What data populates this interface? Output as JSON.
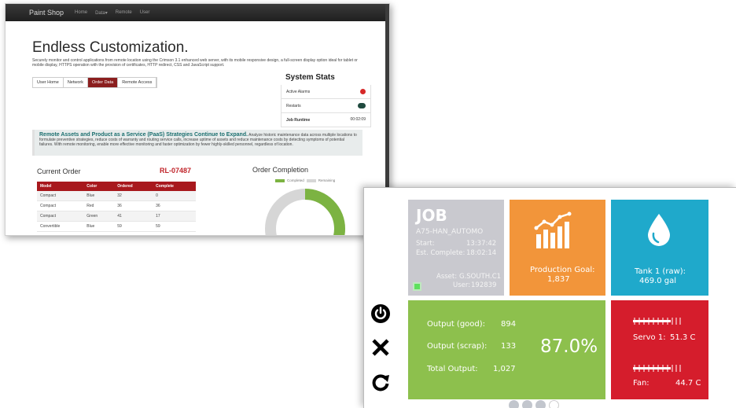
{
  "web": {
    "brand": "Paint Shop",
    "nav": [
      "Home",
      "Data▾",
      "Remote",
      "User"
    ],
    "headline": "Endless Customization.",
    "intro": "Securely monitor and control applications from remote location using the Crimson 3.1 enhanced web server, with its mobile responsive design, a full-screen display option ideal for tablet or mobile display, HTTPS operation with the provision of certificates, HTTP redirect, CSS and JavaScript support.",
    "tabs": [
      {
        "label": "User Home",
        "active": false
      },
      {
        "label": "Network",
        "active": false
      },
      {
        "label": "Order Data",
        "active": true
      },
      {
        "label": "Remote Access",
        "active": false
      }
    ],
    "stats": {
      "title": "System Stats",
      "rows": [
        {
          "label": "Active Alarms",
          "value": "1"
        },
        {
          "label": "Restarts",
          "value": "0"
        },
        {
          "label": "Job Runtime",
          "value": "00:02:09"
        }
      ]
    },
    "banner": {
      "heading": "Remote Assets and Product as a Service (PaaS) Strategies Continue to Expand.",
      "body": "Analyze historic maintenance data across multiple locations to formulate preventive strategies, reduce costs of warranty and routing service calls, increase uptime of assets and reduce maintenance costs by detecting symptoms of potential failures. With remote monitoring, enable more effective monitoring and faster optimization by fewer highly-skilled personnel, regardless of location."
    },
    "current_order": {
      "title": "Current Order",
      "order_id": "RL-07487",
      "columns": [
        "Model",
        "Color",
        "Ordered",
        "Complete"
      ],
      "rows": [
        [
          "Compact",
          "Blue",
          "32",
          "0"
        ],
        [
          "Compact",
          "Red",
          "36",
          "36"
        ],
        [
          "Compact",
          "Green",
          "41",
          "17"
        ],
        [
          "Convertible",
          "Blue",
          "59",
          "59"
        ]
      ]
    },
    "order_completion": {
      "title": "Order Completion",
      "legend_completed": "Completed",
      "legend_remaining": "Remaining",
      "completed_fraction": 0.3,
      "color_completed": "#7cb342",
      "color_remaining": "#d6d6d6"
    }
  },
  "hmi": {
    "job": {
      "title": "JOB",
      "name": "A75-HAN_AUTOMO",
      "start_label": "Start:",
      "start_value": "13:37:42",
      "est_label": "Est. Complete:",
      "est_value": "18:02:14",
      "asset_label": "Asset:",
      "asset_value": "G.SOUTH.C1",
      "user_label": "User:",
      "user_value": "192839"
    },
    "production": {
      "label": "Production Goal:",
      "value": "1,837",
      "icon": "bar-chart-icon"
    },
    "tank": {
      "label": "Tank 1 (raw):",
      "value": "469.0 gal",
      "icon": "water-drop-icon"
    },
    "output": {
      "good_label": "Output (good):",
      "good_value": "894",
      "scrap_label": "Output (scrap):",
      "scrap_value": "133",
      "total_label": "Total Output:",
      "total_value": "1,027",
      "percent": "87.0%"
    },
    "servo": {
      "servo_label": "Servo 1:",
      "servo_value": "51.3 C",
      "fan_label": "Fan:",
      "fan_value": "44.7 C"
    },
    "controls": [
      "power-icon",
      "close-icon",
      "refresh-icon"
    ],
    "pager": {
      "pages": 4,
      "active": 0
    },
    "colors": {
      "job": "#c9c9cf",
      "production": "#f2953a",
      "tank": "#1fa9cb",
      "output": "#8dc04d",
      "servo": "#d51d2c"
    }
  }
}
